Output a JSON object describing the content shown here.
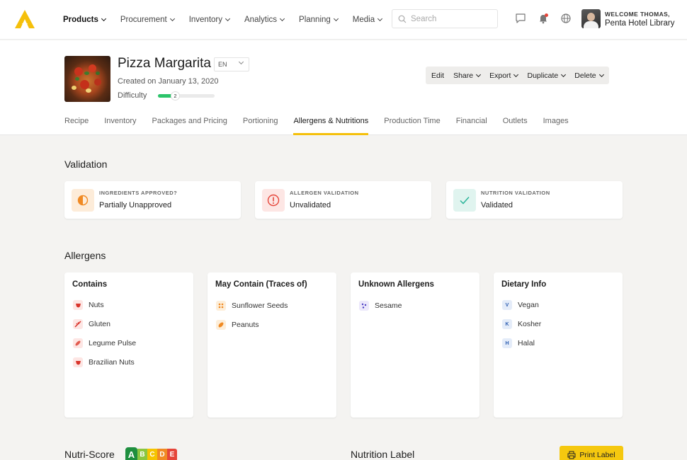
{
  "nav": {
    "items": [
      {
        "label": "Products",
        "active": true
      },
      {
        "label": "Procurement"
      },
      {
        "label": "Inventory"
      },
      {
        "label": "Analytics"
      },
      {
        "label": "Planning"
      },
      {
        "label": "Media"
      }
    ],
    "search_placeholder": "Search",
    "user": {
      "welcome": "WELCOME THOMAS,",
      "org": "Penta Hotel Library"
    }
  },
  "recipe": {
    "title": "Pizza Margarita",
    "language": "EN",
    "created": "Created on January 13, 2020",
    "difficulty_label": "Difficulty",
    "difficulty_value": "2",
    "difficulty_fraction": 0.3
  },
  "actions": [
    "Edit",
    "Share",
    "Export",
    "Duplicate",
    "Delete"
  ],
  "tabs": [
    "Recipe",
    "Inventory",
    "Packages and Pricing",
    "Portioning",
    "Allergens & Nutritions",
    "Production Time",
    "Financial",
    "Outlets",
    "Images"
  ],
  "active_tab": "Allergens & Nutritions",
  "validation": {
    "title": "Validation",
    "cards": [
      {
        "label": "INGREDIENTS APPROVED?",
        "value": "Partially Unapproved",
        "icon": "half-circle-icon",
        "color": "#f08a24"
      },
      {
        "label": "ALLERGEN VALIDATION",
        "value": "Unvalidated",
        "icon": "alert-circle-icon",
        "color": "#e5453a"
      },
      {
        "label": "NUTRITION VALIDATION",
        "value": "Validated",
        "icon": "check-icon",
        "color": "#2bb59a"
      }
    ]
  },
  "allergens": {
    "title": "Allergens",
    "cards": [
      {
        "heading": "Contains",
        "items": [
          "Nuts",
          "Gluten",
          "Legume Pulse",
          "Brazilian Nuts"
        ]
      },
      {
        "heading": "May Contain (Traces of)",
        "items": [
          "Sunflower Seeds",
          "Peanuts"
        ]
      },
      {
        "heading": "Unknown Allergens",
        "items": [
          "Sesame"
        ]
      },
      {
        "heading": "Dietary Info",
        "items": [
          "Vegan",
          "Kosher",
          "Halal"
        ],
        "badges": [
          "V",
          "K",
          "H"
        ]
      }
    ]
  },
  "nutri_score": {
    "title": "Nutri-Score",
    "grades": [
      "A",
      "B",
      "C",
      "D",
      "E"
    ],
    "selected": "A",
    "colors": [
      "#1e8f3f",
      "#8cc63f",
      "#f5c400",
      "#f08a24",
      "#e5453a"
    ]
  },
  "nutrition_label": {
    "title": "Nutrition Label",
    "print_button": "Print Label"
  }
}
